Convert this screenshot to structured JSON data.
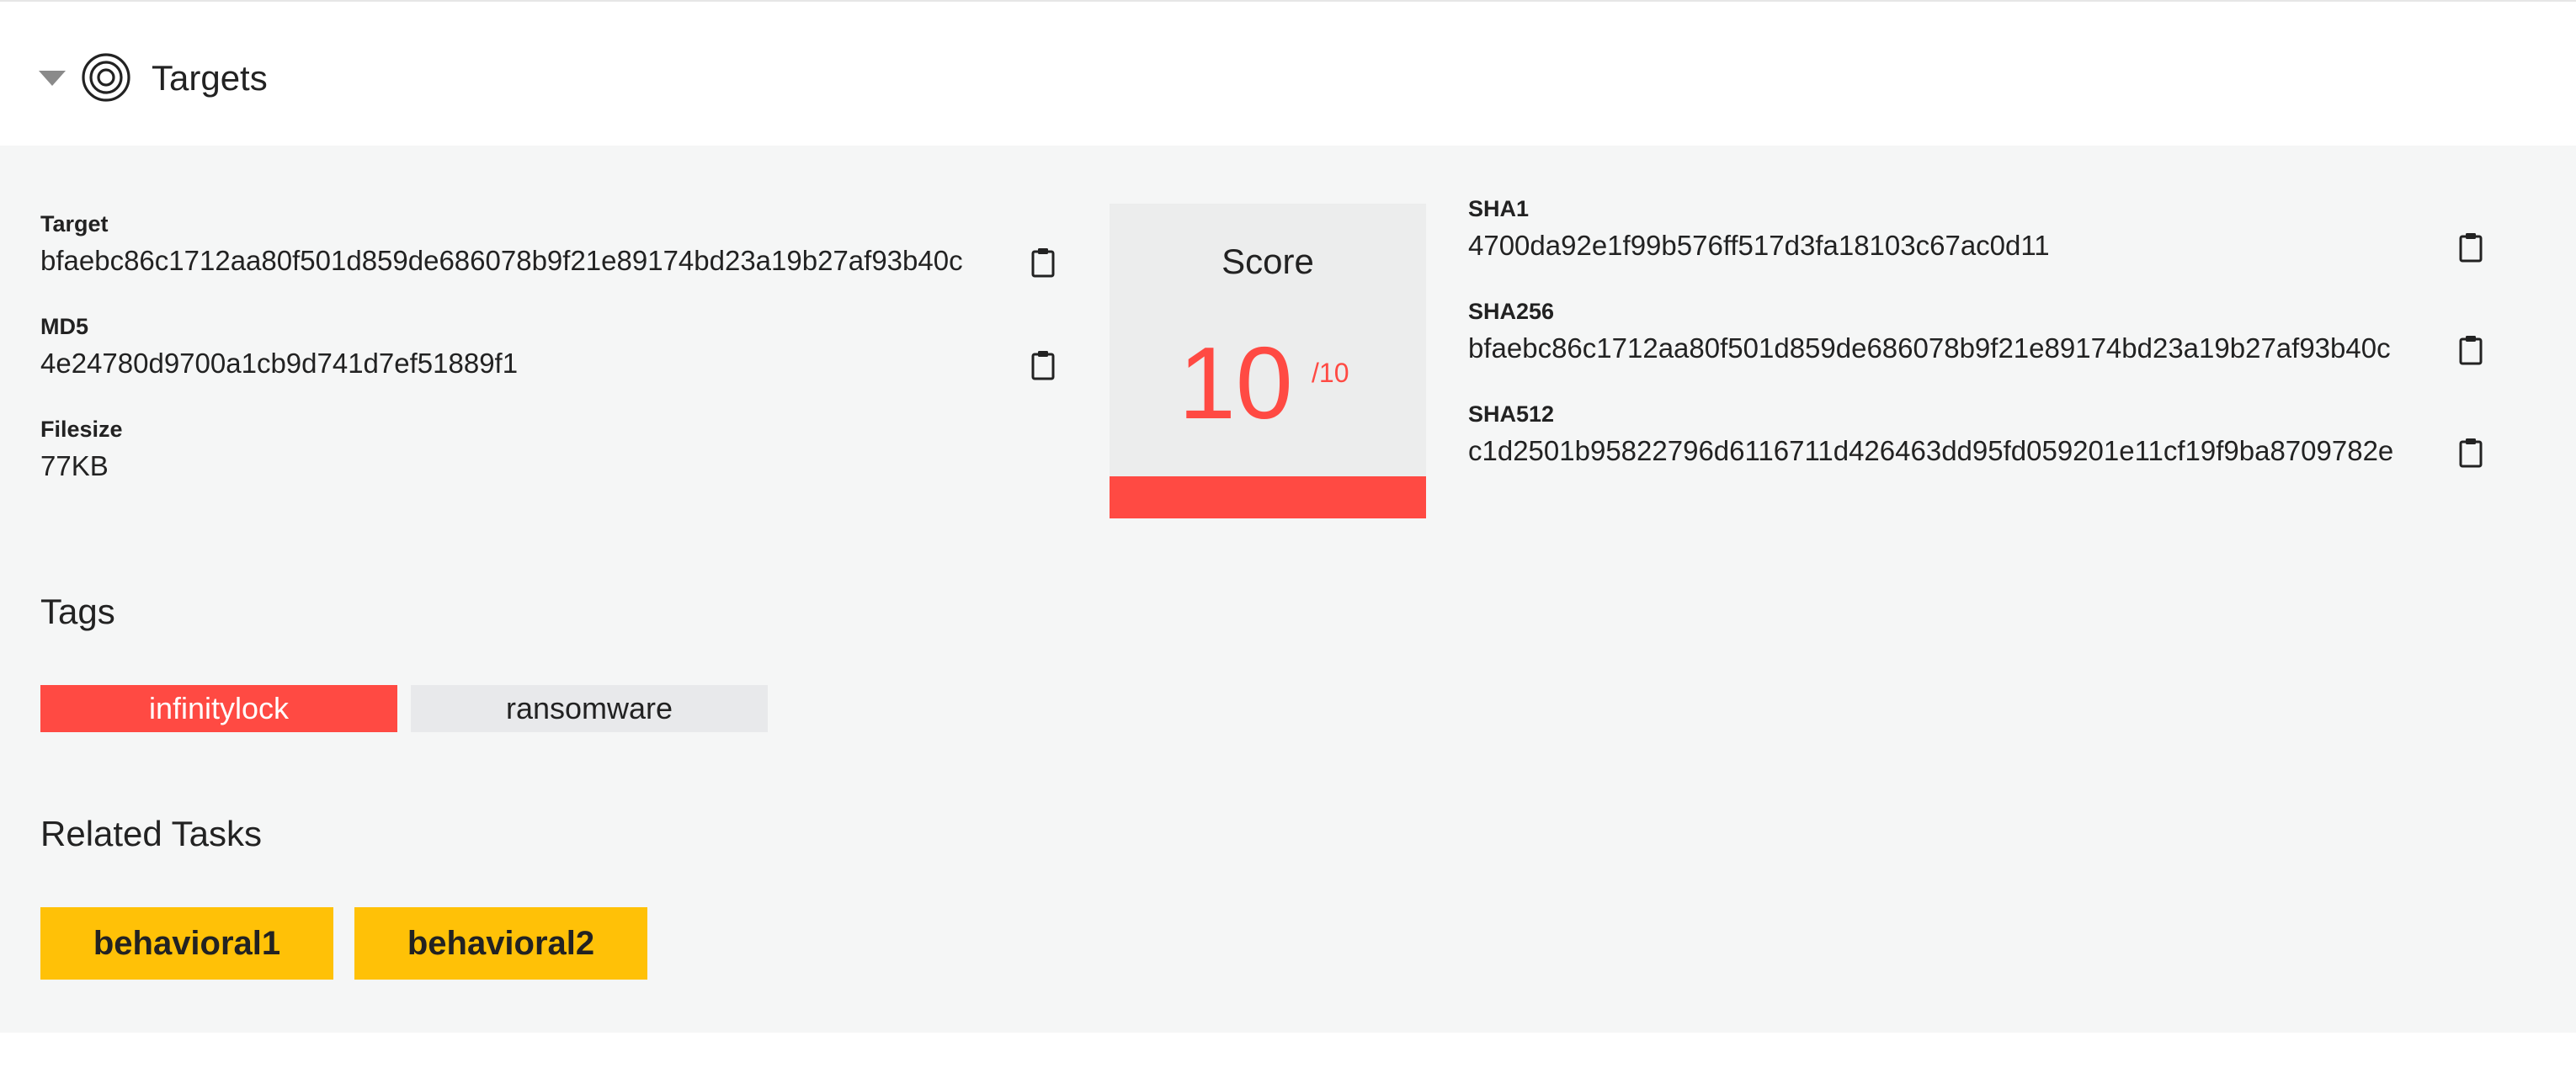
{
  "header": {
    "title": "Targets",
    "toggle_icon": "caret-down-icon",
    "section_icon": "target-icon"
  },
  "left_fields": [
    {
      "label": "Target",
      "value": "bfaebc86c1712aa80f501d859de686078b9f21e89174bd23a19b27af93b40c"
    },
    {
      "label": "MD5",
      "value": "4e24780d9700a1cb9d741d7ef51889f1"
    },
    {
      "label": "Filesize",
      "value": "77KB"
    }
  ],
  "score": {
    "title": "Score",
    "value": "10",
    "max": "/10",
    "fraction": 1.0,
    "color": "#ff4a43"
  },
  "right_fields": [
    {
      "label": "SHA1",
      "value": "4700da92e1f99b576ff517d3fa18103c67ac0d11"
    },
    {
      "label": "SHA256",
      "value": "bfaebc86c1712aa80f501d859de686078b9f21e89174bd23a19b27af93b40c"
    },
    {
      "label": "SHA512",
      "value": "c1d2501b95822796d6116711d426463dd95fd059201e11cf19f9ba8709782e"
    }
  ],
  "tags": {
    "heading": "Tags",
    "items": [
      {
        "label": "infinitylock",
        "color": "#ff4a43"
      },
      {
        "label": "ransomware",
        "color": "#e8e9eb"
      }
    ]
  },
  "related_tasks": {
    "heading": "Related Tasks",
    "items": [
      {
        "label": "behavioral1",
        "color": "#ffc107"
      },
      {
        "label": "behavioral2",
        "color": "#ffc107"
      }
    ]
  },
  "icons": {
    "copy": "clipboard-icon"
  }
}
